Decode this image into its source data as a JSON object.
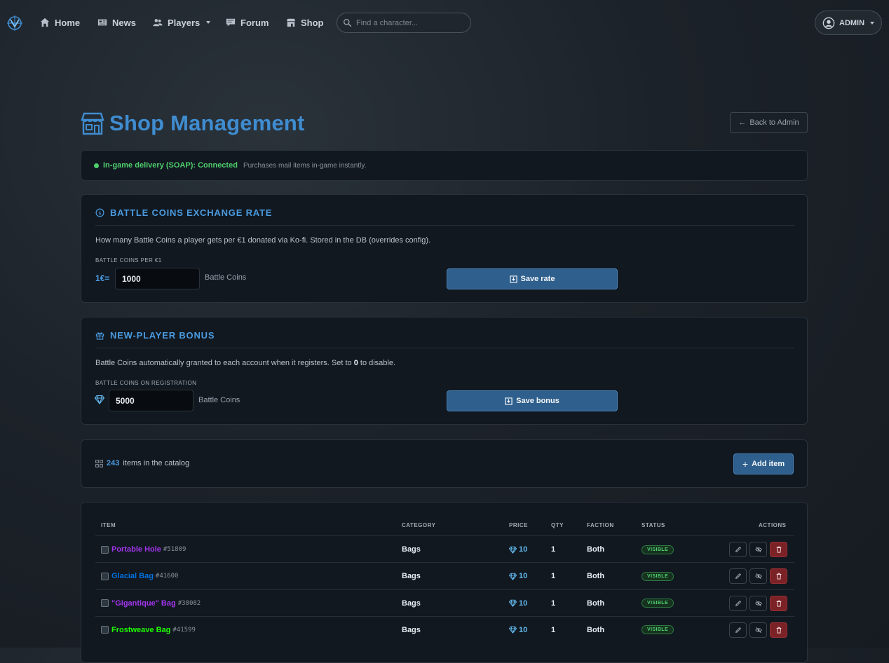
{
  "nav": {
    "items": [
      {
        "label": "Home",
        "icon": "home-icon"
      },
      {
        "label": "News",
        "icon": "news-icon"
      },
      {
        "label": "Players",
        "icon": "players-icon"
      },
      {
        "label": "Forum",
        "icon": "forum-icon"
      },
      {
        "label": "Shop",
        "icon": "shop-icon"
      }
    ],
    "search_placeholder": "Find a character...",
    "user_label": "ADMIN"
  },
  "header": {
    "title": "Shop Management",
    "back_label": "Back to Admin"
  },
  "soap": {
    "status": "In-game delivery (SOAP): Connected",
    "note": "Purchases mail items in-game instantly."
  },
  "exchange": {
    "title": "BATTLE COINS EXCHANGE RATE",
    "description": "How many Battle Coins a player gets per €1 donated via Ko-fi. Stored in the DB (overrides config).",
    "field_label": "BATTLE COINS PER €1",
    "prefix": "1€=",
    "value": "1000",
    "suffix": "Battle Coins",
    "save_label": "Save rate"
  },
  "bonus": {
    "title": "NEW-PLAYER BONUS",
    "description_before": "Battle Coins automatically granted to each account when it registers. Set to ",
    "description_bold": "0",
    "description_after": " to disable.",
    "field_label": "BATTLE COINS ON REGISTRATION",
    "value": "5000",
    "suffix": "Battle Coins",
    "save_label": "Save bonus"
  },
  "catalog": {
    "count": "243",
    "count_text": "items in the catalog",
    "add_label": "Add item"
  },
  "table": {
    "headers": {
      "item": "ITEM",
      "category": "CATEGORY",
      "price": "PRICE",
      "qty": "QTY",
      "faction": "FACTION",
      "status": "STATUS",
      "actions": "ACTIONS"
    },
    "rows": [
      {
        "name": "Portable Hole",
        "id": "#51809",
        "color": "#a335ee",
        "category": "Bags",
        "price": "10",
        "qty": "1",
        "faction": "Both",
        "status": "VISIBLE"
      },
      {
        "name": "Glacial Bag",
        "id": "#41600",
        "color": "#0070dd",
        "category": "Bags",
        "price": "10",
        "qty": "1",
        "faction": "Both",
        "status": "VISIBLE"
      },
      {
        "name": "\"Gigantique\" Bag",
        "id": "#38082",
        "color": "#a335ee",
        "category": "Bags",
        "price": "10",
        "qty": "1",
        "faction": "Both",
        "status": "VISIBLE"
      },
      {
        "name": "Frostweave Bag",
        "id": "#41599",
        "color": "#1eff00",
        "category": "Bags",
        "price": "10",
        "qty": "1",
        "faction": "Both",
        "status": "VISIBLE"
      }
    ]
  },
  "colors": {
    "accent": "#4a9be0",
    "success": "#4fcf6d",
    "danger": "#7a2226",
    "button": "#2f5f8c"
  }
}
